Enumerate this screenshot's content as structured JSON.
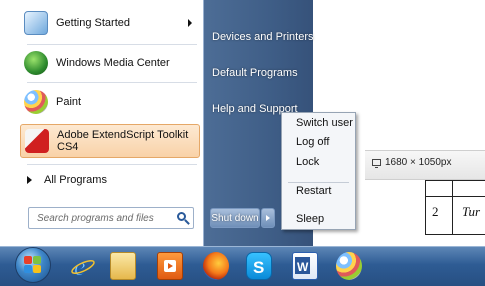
{
  "left_menu": {
    "items": [
      {
        "label": "Getting Started",
        "has_submenu": true,
        "icon": "getting-started-icon"
      },
      {
        "label": "Windows Media Center",
        "has_submenu": false,
        "icon": "windows-media-center-icon"
      },
      {
        "label": "Paint",
        "has_submenu": false,
        "icon": "paint-icon"
      },
      {
        "label": "Adobe ExtendScript Toolkit CS4",
        "has_submenu": false,
        "icon": "extendscript-toolkit-icon",
        "highlighted": true
      }
    ],
    "all_programs_label": "All Programs",
    "search_placeholder": "Search programs and files"
  },
  "right_menu": {
    "items": [
      "Devices and Printers",
      "Default Programs",
      "Help and Support"
    ]
  },
  "shutdown": {
    "button_label": "Shut down"
  },
  "shutdown_submenu": {
    "items": [
      "Switch user",
      "Log off",
      "Lock",
      "Restart",
      "Sleep"
    ]
  },
  "background_document": {
    "resolution_label": "1680 × 1050px",
    "table_number": "2",
    "table_word": "Tur"
  },
  "taskbar": {
    "icons": [
      "start-orb-icon",
      "internet-explorer-icon",
      "windows-explorer-icon",
      "media-player-icon",
      "firefox-icon",
      "skype-icon",
      "word-icon",
      "paint-icon"
    ]
  },
  "colors": {
    "menu_right_pane": "#3f5e87",
    "taskbar": "#2e5c94",
    "highlight": "#f9d2a8"
  }
}
